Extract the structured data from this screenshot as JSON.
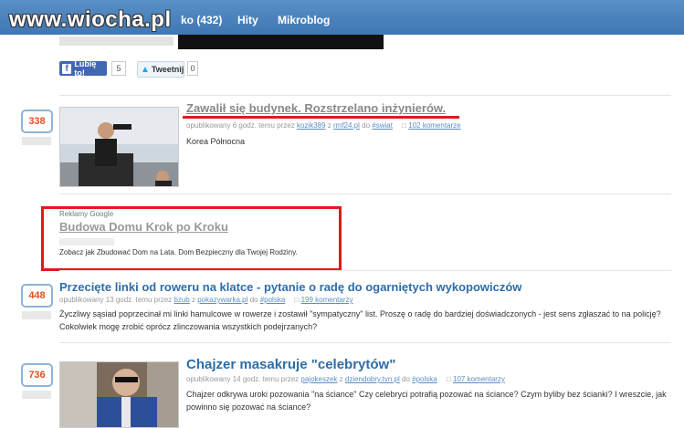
{
  "header": {
    "logo": "www.wiocha.pl",
    "nav": [
      "ko (432)",
      "Hity",
      "Mikroblog"
    ]
  },
  "share": {
    "like_label": "Lubię to!",
    "like_count": "5",
    "tweet_label": "Tweetnij",
    "tweet_count": "0"
  },
  "posts": [
    {
      "votes": "338",
      "title": "Zawalił się budynek. Rozstrzelano inżynierów.",
      "meta_pub": "opublikowany 6 godz. temu przez ",
      "meta_user": "kozik389",
      "meta_from": " z ",
      "meta_source": "rmf24.pl",
      "meta_in": " do ",
      "meta_cat": "#swiat",
      "comments": "102 komentarze",
      "description": "Korea Północna"
    },
    {
      "votes": "448",
      "title": "Przecięte linki od roweru na klatce - pytanie o radę do ogarniętych wykopowiczów",
      "meta_pub": "opublikowany 13 godz. temu przez ",
      "meta_user": "bzub",
      "meta_from": " z ",
      "meta_source": "pokazywarka.pl",
      "meta_in": " do ",
      "meta_cat": "#polska",
      "comments": "199 komentarzy",
      "description": "Życzliwy sąsiad poprzecinał mi linki hamulcowe w rowerze i zostawił \"sympatyczny\" list. Proszę o radę do bardziej doświadczonych - jest sens zgłaszać to na policję? Cokolwiek mogę zrobić oprócz zlinczowania wszystkich podejrzanych?"
    },
    {
      "votes": "736",
      "title": "Chajzer masakruje \"celebrytów\"",
      "meta_pub": "opublikowany 14 godz. temu przez ",
      "meta_user": "pajokeszek",
      "meta_from": " z ",
      "meta_source": "dziendobry.tvn.pl",
      "meta_in": " do ",
      "meta_cat": "#polska",
      "comments": "107 komentarzy",
      "description": "Chajzer odkrywa uroki pozowania \"na ściance\" Czy celebryci potrafią pozować na ściance? Czym byliby bez ścianki? I wreszcie, jak powinno się pozować na ściance?"
    }
  ],
  "ad": {
    "label": "Reklamy Google",
    "title": "Budowa Domu Krok po Kroku",
    "text": "Zobacz jak Zbudować Dom na Lata. Dom Bezpieczny dla Twojej Rodziny."
  }
}
